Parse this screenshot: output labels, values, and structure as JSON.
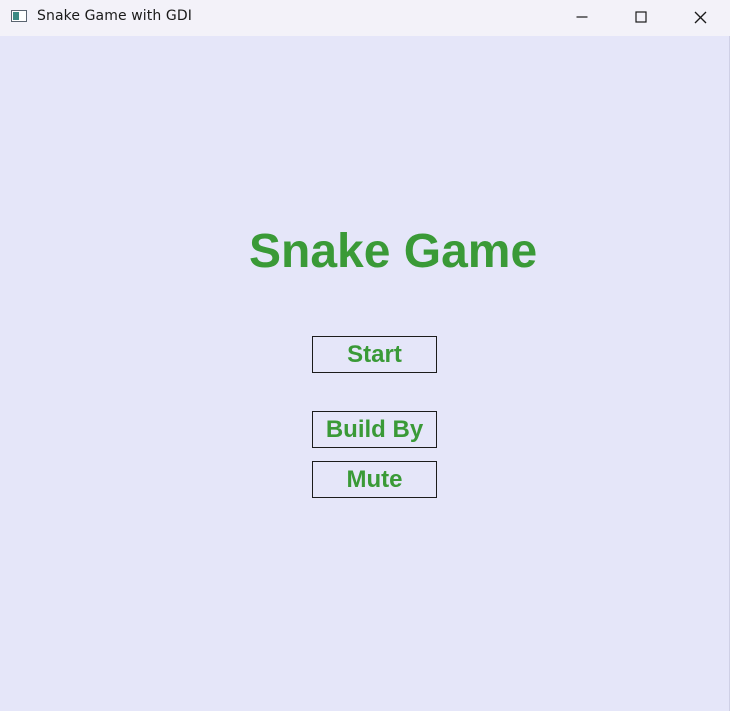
{
  "window": {
    "title": "Snake Game with GDI"
  },
  "titlebar": {
    "controls": {
      "minimize_icon": "minimize-icon",
      "maximize_icon": "maximize-icon",
      "close_icon": "close-icon"
    }
  },
  "game": {
    "title": "Snake Game",
    "menu": {
      "start_label": "Start",
      "build_by_label": "Build By",
      "mute_label": "Mute"
    }
  },
  "colors": {
    "background": "#e5e6f9",
    "titlebar": "#f3f2f9",
    "accent_green": "#3a9a37",
    "button_border": "#1c1c1c"
  }
}
